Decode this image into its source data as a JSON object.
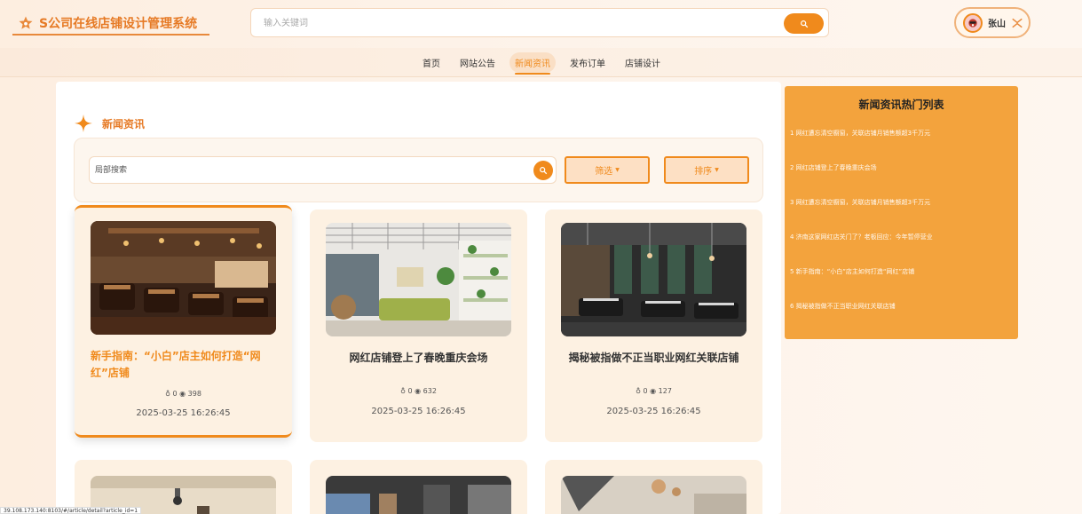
{
  "header": {
    "title": "S公司在线店铺设计管理系统",
    "search_placeholder": "输入关键词",
    "user_name": "张山"
  },
  "nav": {
    "items": [
      {
        "label": "首页"
      },
      {
        "label": "网站公告"
      },
      {
        "label": "新闻资讯"
      },
      {
        "label": "发布订单"
      },
      {
        "label": "店铺设计"
      }
    ],
    "active": "新闻资讯"
  },
  "main": {
    "section_title": "新闻资讯",
    "local_search_placeholder": "局部搜索",
    "filter_label": "筛选",
    "sort_label": "排序",
    "cards": [
      {
        "title": "新手指南：“小白”店主如何打造“网红”店铺",
        "likes": "0",
        "views": "398",
        "date": "2025-03-25 16:26:45"
      },
      {
        "title": "网红店铺登上了春晚重庆会场",
        "likes": "0",
        "views": "632",
        "date": "2025-03-25 16:26:45"
      },
      {
        "title": "揭秘被指做不正当职业网红关联店铺",
        "likes": "0",
        "views": "127",
        "date": "2025-03-25 16:26:45"
      }
    ]
  },
  "sidebar": {
    "title": "新闻资讯热门列表",
    "items": [
      {
        "label": "1  网红遭忘清空橱窗，关联店铺月销售额超3千万元"
      },
      {
        "label": "2  网红店铺登上了春晚重庆会场"
      },
      {
        "label": "3  网红遭忘清空橱窗，关联店铺月销售额超3千万元"
      },
      {
        "label": "4  济南这家网红店关门了？老板回应：今年暂停营业"
      },
      {
        "label": "5  新手指南：“小白”店主如何打造“网红”店铺"
      },
      {
        "label": "6  揭秘被指做不正当职业网红关联店铺"
      }
    ]
  },
  "status_url": "39.108.173.140:8103/#/article/detail?article_id=1",
  "colors": {
    "accent": "#f08a1c",
    "sidebar_bg": "#f3a33d",
    "card_bg": "#fdf1e2"
  }
}
